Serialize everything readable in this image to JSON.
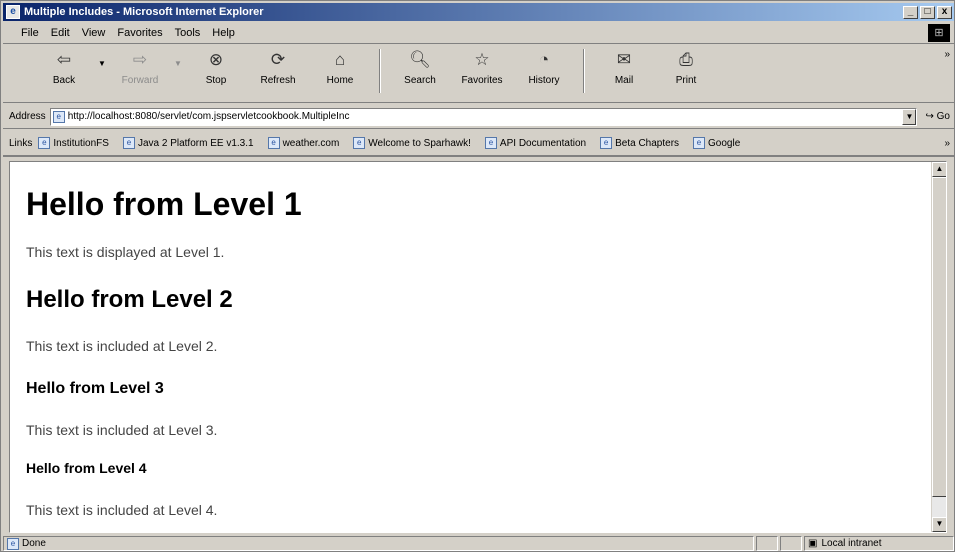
{
  "window": {
    "title": "Multiple Includes - Microsoft Internet Explorer",
    "minimize": "_",
    "maximize": "□",
    "close": "x"
  },
  "menu": [
    "File",
    "Edit",
    "View",
    "Favorites",
    "Tools",
    "Help"
  ],
  "toolbar": {
    "back": "Back",
    "forward": "Forward",
    "stop": "Stop",
    "refresh": "Refresh",
    "home": "Home",
    "search": "Search",
    "favorites": "Favorites",
    "history": "History",
    "mail": "Mail",
    "print": "Print"
  },
  "address": {
    "label": "Address",
    "url": "http://localhost:8080/servlet/com.jspservletcookbook.MultipleInc",
    "go": "Go"
  },
  "links": {
    "label": "Links",
    "items": [
      "InstitutionFS",
      "Java 2 Platform EE v1.3.1",
      "weather.com",
      "Welcome to Sparhawk!",
      "API Documentation",
      "Beta Chapters",
      "Google"
    ]
  },
  "content": {
    "h1": "Hello from Level 1",
    "p1": "This text is displayed at Level 1.",
    "h2": "Hello from Level 2",
    "p2": "This text is included at Level 2.",
    "h3": "Hello from Level 3",
    "p3": "This text is included at Level 3.",
    "h4": "Hello from Level 4",
    "p4": "This text is included at Level 4."
  },
  "status": {
    "text": "Done",
    "zone": "Local intranet"
  }
}
